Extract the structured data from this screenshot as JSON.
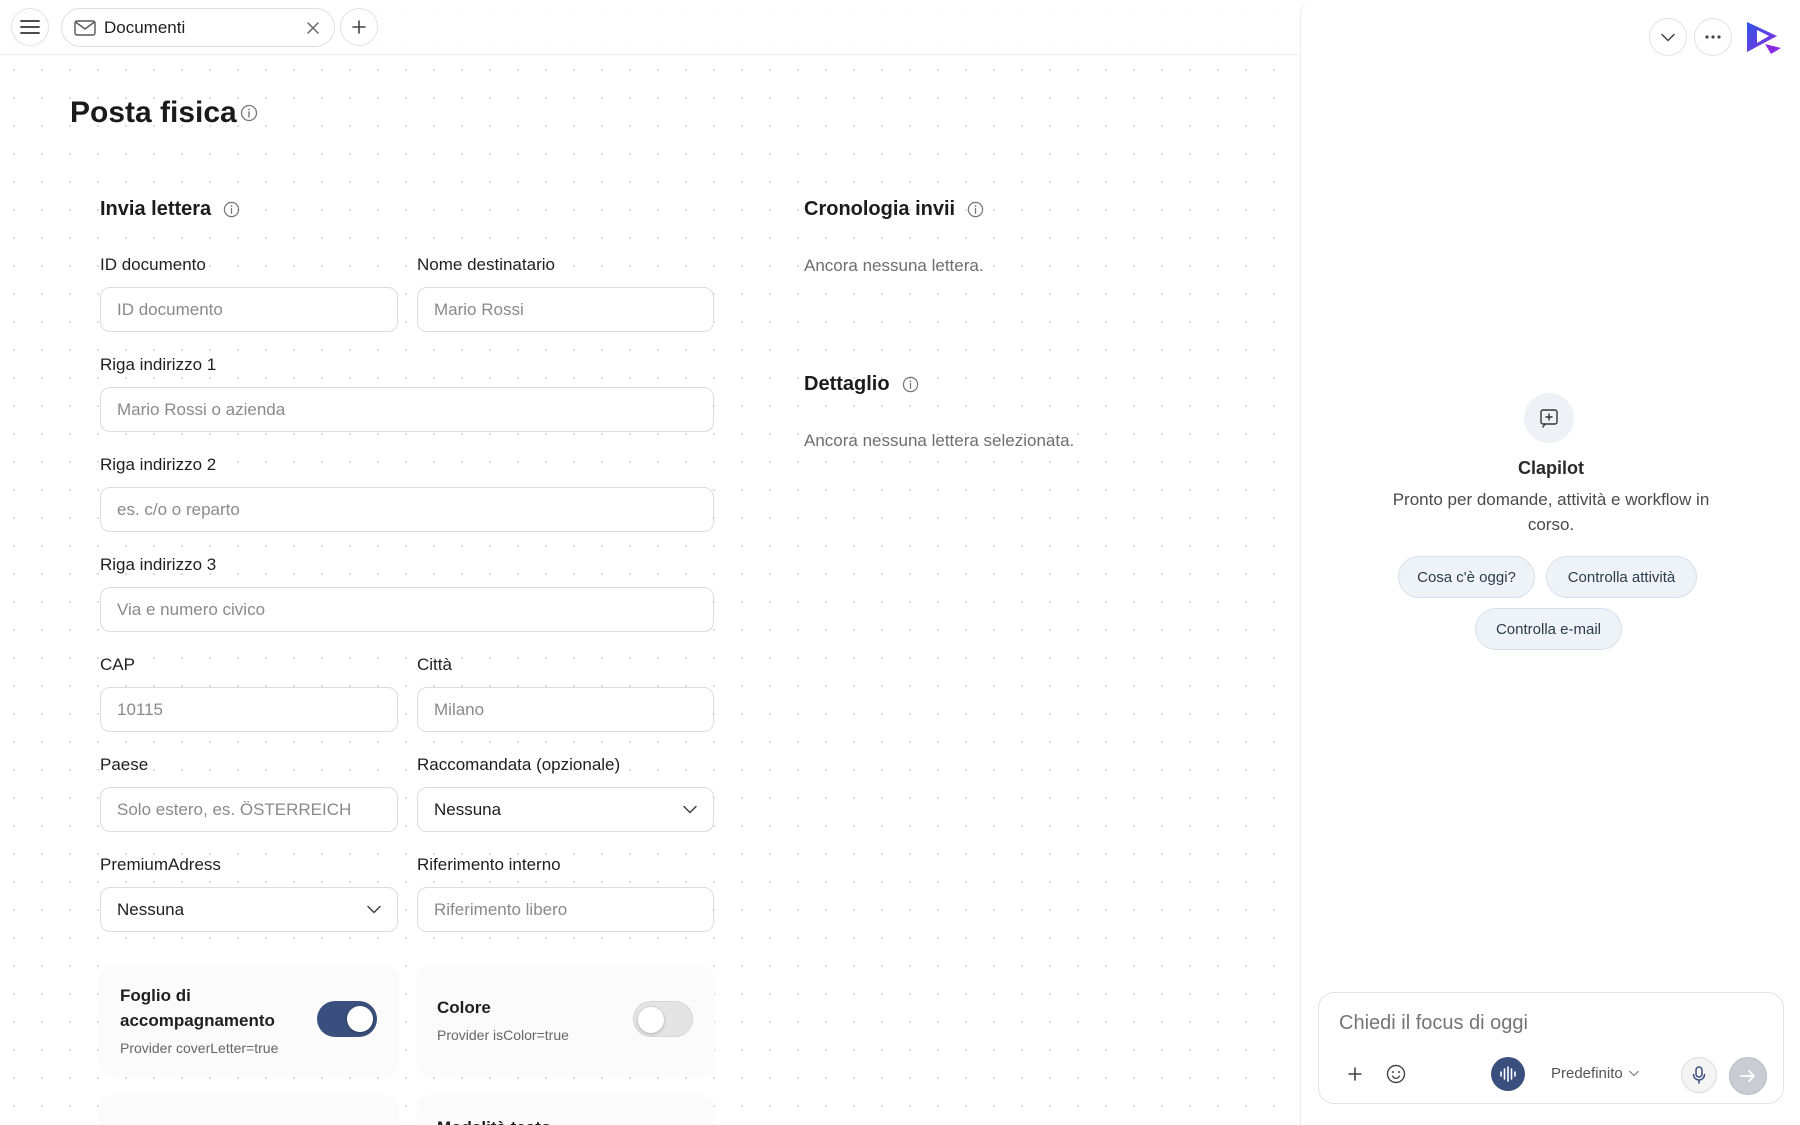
{
  "tab": {
    "label": "Documenti"
  },
  "page": {
    "title": "Posta fisica"
  },
  "send_letter": {
    "title": "Invia lettera",
    "fields": {
      "document_id": {
        "label": "ID documento",
        "placeholder": "ID documento"
      },
      "recipient_name": {
        "label": "Nome destinatario",
        "placeholder": "Mario Rossi"
      },
      "address_line1": {
        "label": "Riga indirizzo 1",
        "placeholder": "Mario Rossi o azienda"
      },
      "address_line2": {
        "label": "Riga indirizzo 2",
        "placeholder": "es. c/o o reparto"
      },
      "address_line3": {
        "label": "Riga indirizzo 3",
        "placeholder": "Via e numero civico"
      },
      "zip": {
        "label": "CAP",
        "placeholder": "10115"
      },
      "city": {
        "label": "Città",
        "placeholder": "Milano"
      },
      "country": {
        "label": "Paese",
        "placeholder": "Solo estero, es. ÖSTERREICH"
      },
      "registered": {
        "label": "Raccomandata (opzionale)",
        "value": "Nessuna"
      },
      "premium_address": {
        "label": "PremiumAdress",
        "value": "Nessuna"
      },
      "internal_ref": {
        "label": "Riferimento interno",
        "placeholder": "Riferimento libero"
      }
    },
    "toggles": {
      "cover_letter": {
        "title_line1": "Foglio di",
        "title_line2": "accompagnamento",
        "sub": "Provider coverLetter=true",
        "on": true
      },
      "color": {
        "title": "Colore",
        "sub": "Provider isColor=true",
        "on": false
      }
    },
    "next_card_partial": "Modalità testo"
  },
  "history": {
    "title": "Cronologia invii",
    "empty": "Ancora nessuna lettera."
  },
  "detail": {
    "title": "Dettaglio",
    "empty": "Ancora nessuna lettera selezionata."
  },
  "assistant": {
    "name": "Clapilot",
    "tagline": "Pronto per domande, attività e workflow in corso.",
    "chips": [
      "Cosa c'è oggi?",
      "Controlla attività",
      "Controlla e-mail"
    ],
    "input_placeholder": "Chiedi il focus di oggi",
    "model": "Predefinito"
  },
  "colors": {
    "accent": "#3a4f7d",
    "chip_bg": "#eef3f8",
    "brand_blue": "#2f57e6",
    "brand_purple": "#8a2be2"
  }
}
